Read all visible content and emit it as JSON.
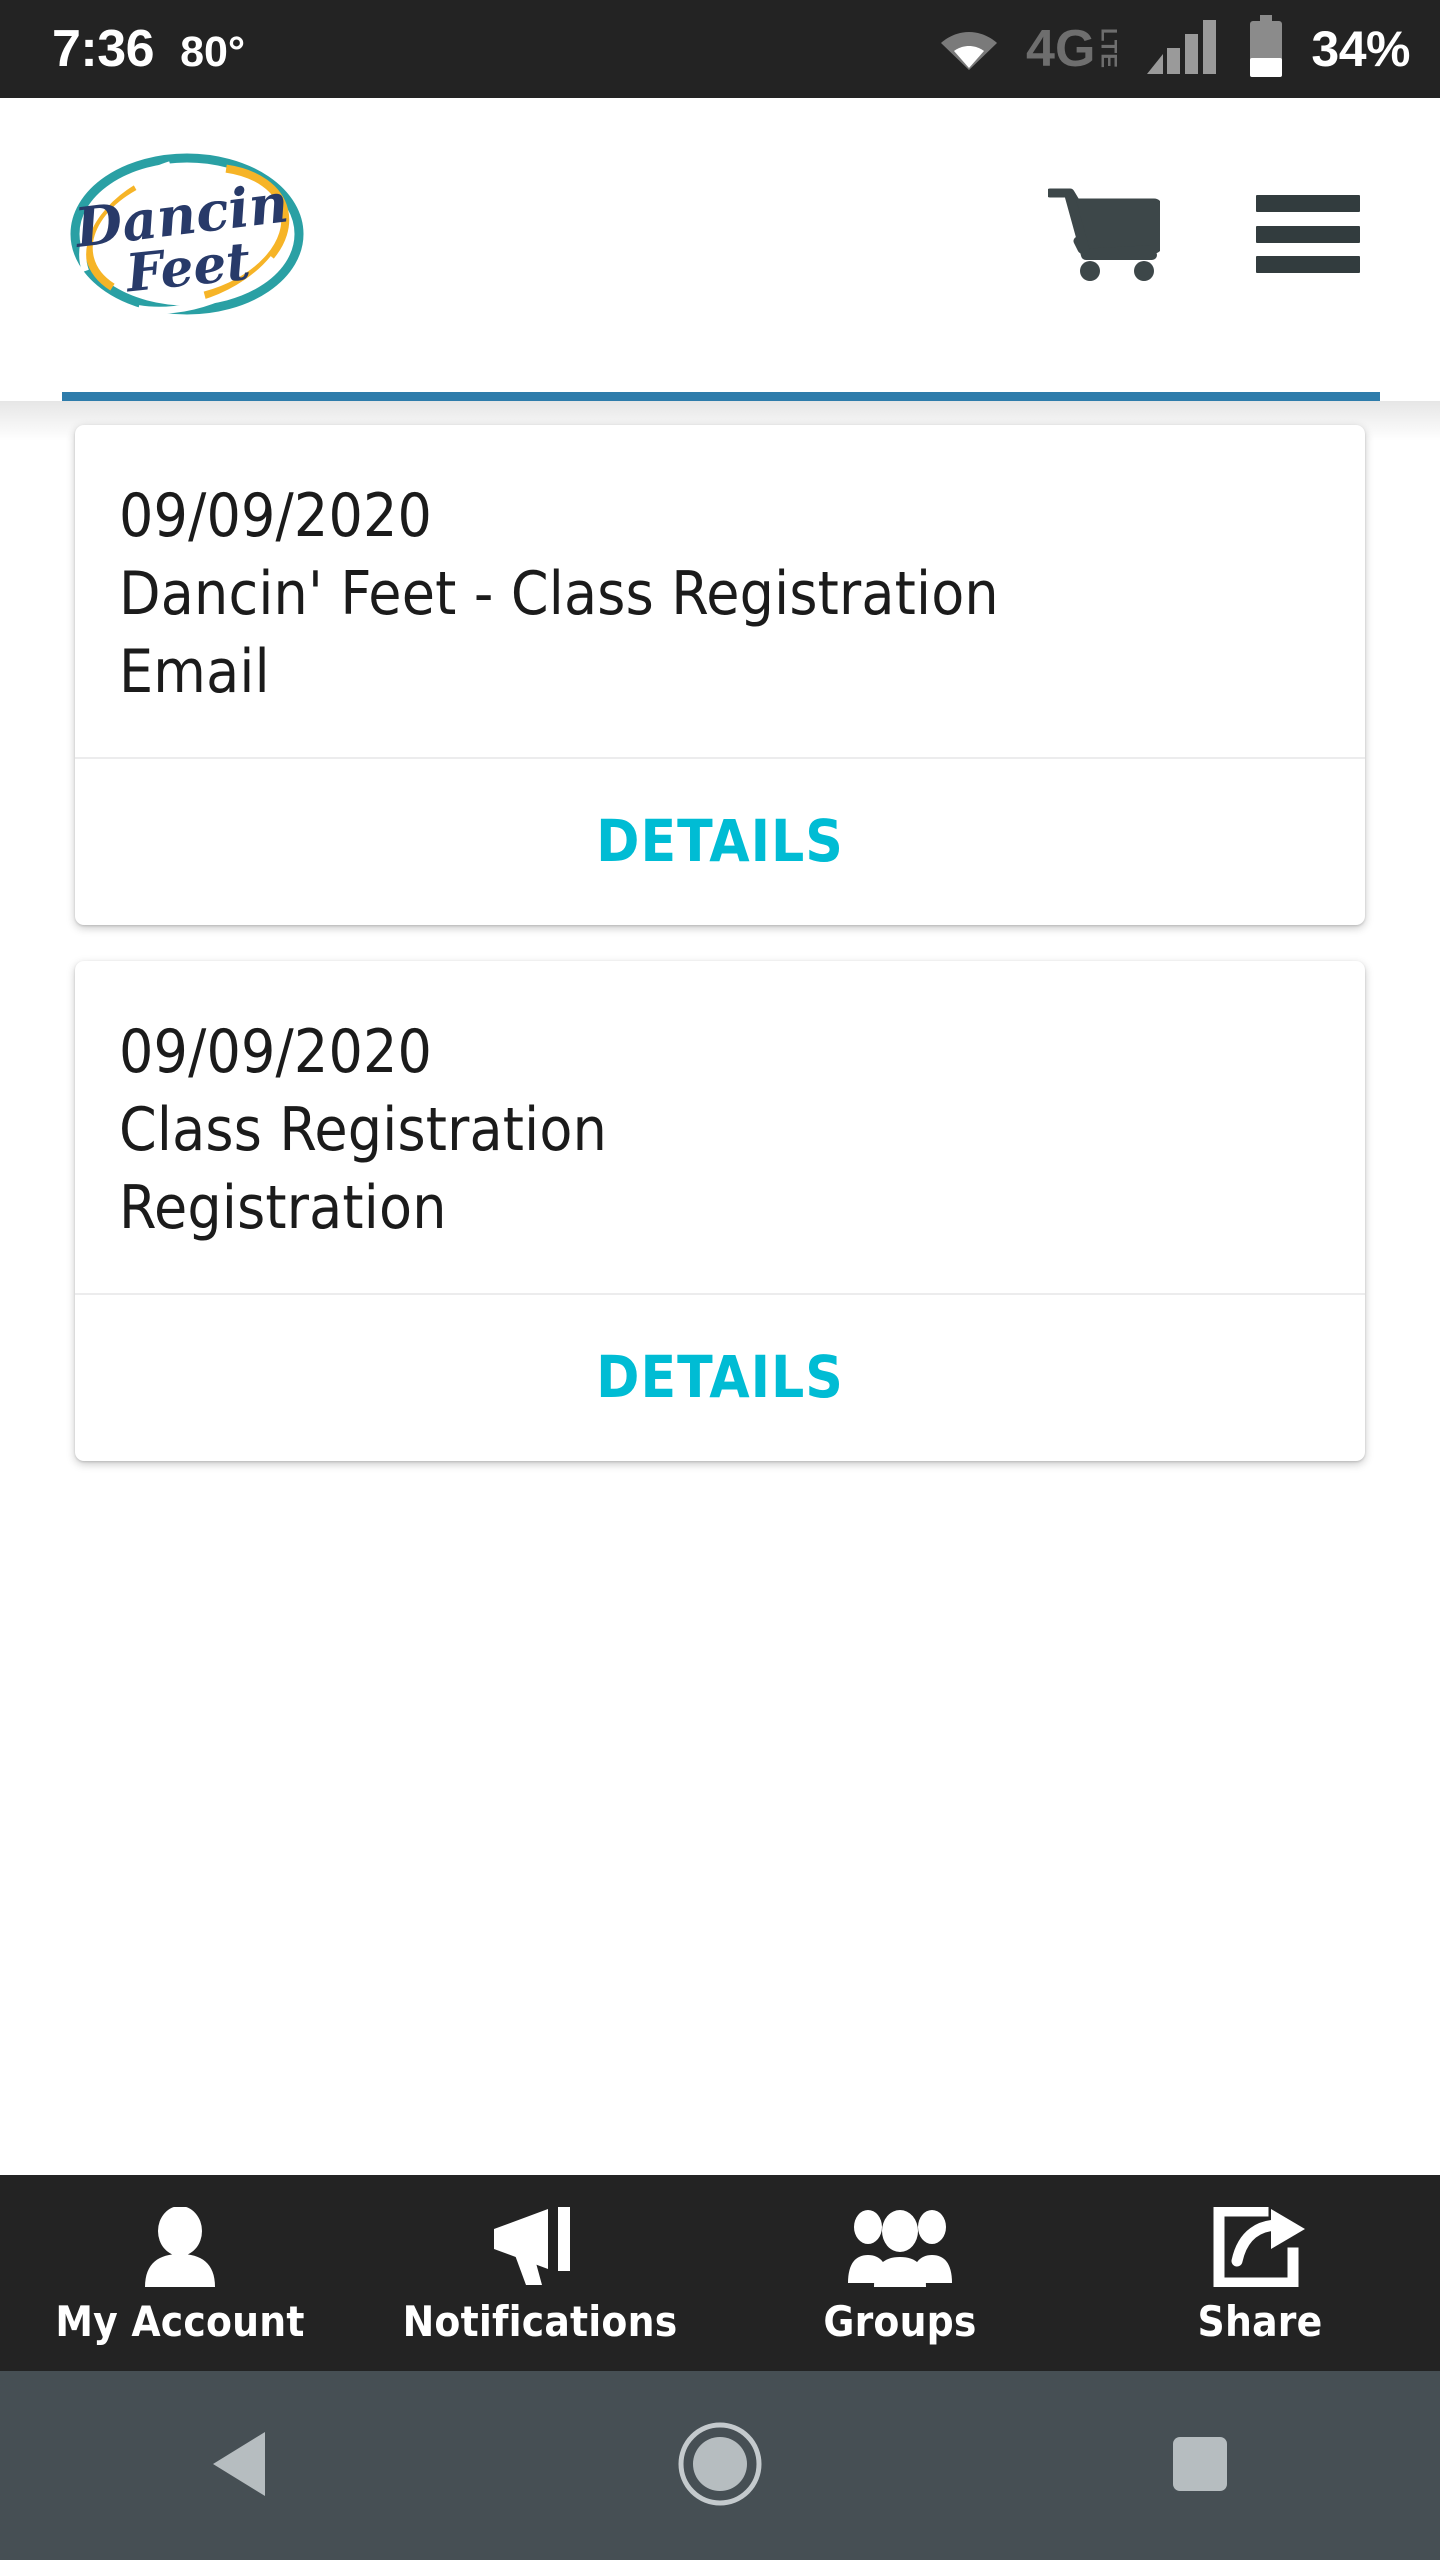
{
  "status_bar": {
    "time": "7:36",
    "temperature": "80°",
    "network_label": "4G",
    "network_sub": "LTE",
    "battery_percent": "34%",
    "icons": [
      "wifi-icon",
      "network-4glte-icon",
      "signal-bars-icon",
      "battery-icon"
    ],
    "background": "#232323"
  },
  "header": {
    "logo_alt": "Dancin' Feet",
    "logo_text_top": "Dancin'",
    "logo_text_bottom": "Feet",
    "logo_colors": {
      "script": "#283a69",
      "oval_ring": "#2aa0a4",
      "accent": "#f6b427"
    },
    "cart_label": "Shopping Cart",
    "menu_label": "Menu",
    "icon_color": "#323c3e",
    "rule_color": "#2E7CAB"
  },
  "cards": [
    {
      "date": "09/09/2020",
      "title": "Dancin' Feet - Class Registration",
      "subtitle": "Email",
      "action_label": "DETAILS"
    },
    {
      "date": "09/09/2020",
      "title": "Class Registration",
      "subtitle": "Registration",
      "action_label": "DETAILS"
    }
  ],
  "accent_color": "#00BCD4",
  "tab_bar": {
    "background": "#232323",
    "items": [
      {
        "label": "My Account",
        "icon": "person-icon"
      },
      {
        "label": "Notifications",
        "icon": "megaphone-icon"
      },
      {
        "label": "Groups",
        "icon": "people-group-icon"
      },
      {
        "label": "Share",
        "icon": "share-export-icon"
      }
    ]
  },
  "system_nav": {
    "background": "#464f54",
    "buttons": [
      {
        "name": "back-button",
        "icon": "triangle-left-icon"
      },
      {
        "name": "home-button",
        "icon": "circle-icon"
      },
      {
        "name": "recents-button",
        "icon": "square-icon"
      }
    ]
  }
}
